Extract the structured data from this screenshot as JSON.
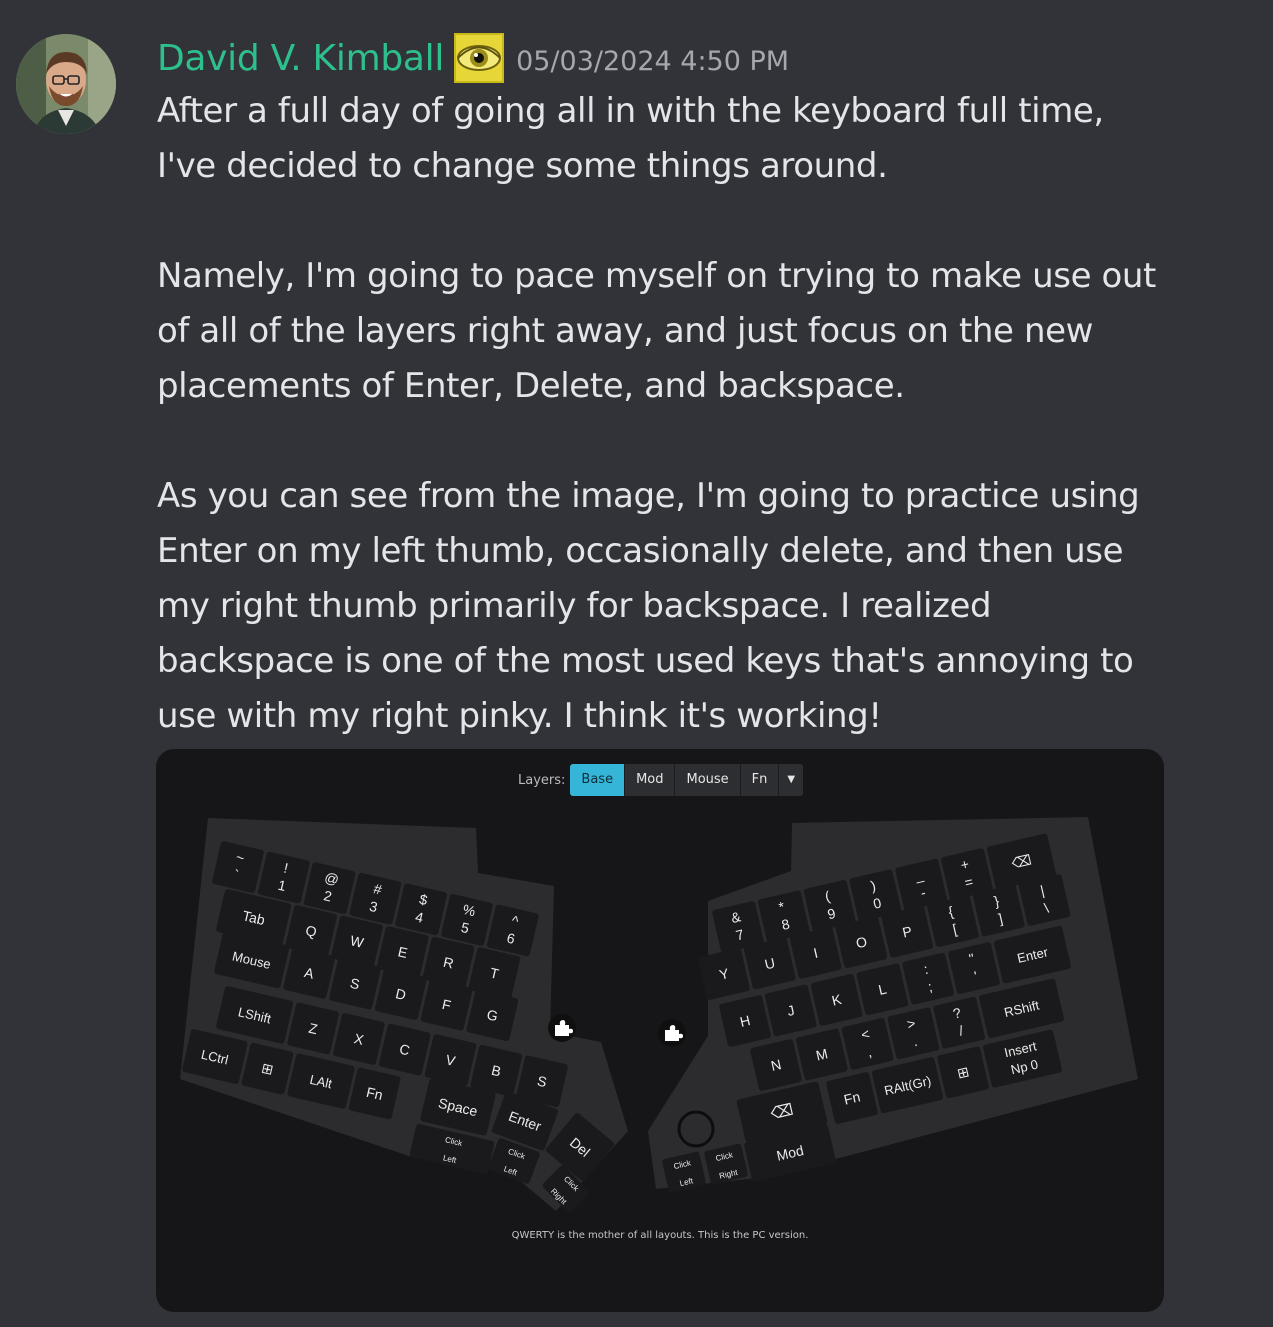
{
  "author": {
    "name": "David V. Kimball",
    "timestamp": "05/03/2024 4:50 PM",
    "name_color": "#2dc08d",
    "badge": "yellow-eye-icon"
  },
  "message": {
    "paragraphs": [
      "After a full day of going all in with the keyboard full time, I've decided to change some things around.",
      "Namely, I'm going to pace myself on trying to make use out of all of the layers right away, and just focus on the new placements of Enter, Delete, and backspace.",
      "As you can see from the image, I'm going to practice using Enter on my left thumb, occasionally delete, and then use my right thumb primarily for backspace. I realized backspace is one of the most used keys that's annoying to use with my right pinky. I think it's working!"
    ]
  },
  "attachment": {
    "layers_label": "Layers:",
    "tabs": [
      "Base",
      "Mod",
      "Mouse",
      "Fn"
    ],
    "active_tab": "Base",
    "caption": "QWERTY is the mother of all layouts. This is the PC version.",
    "accent": "#35b5d8",
    "keyboard": {
      "left_rows": [
        [
          [
            "~",
            "`"
          ],
          [
            "!",
            "1"
          ],
          [
            "@",
            "2"
          ],
          [
            "#",
            "3"
          ],
          [
            "$",
            "4"
          ],
          [
            "%",
            "5"
          ],
          [
            "^",
            "6"
          ]
        ],
        [
          [
            "Tab"
          ],
          [
            "Q"
          ],
          [
            "W"
          ],
          [
            "E"
          ],
          [
            "R"
          ],
          [
            "T"
          ]
        ],
        [
          [
            "Mouse"
          ],
          [
            "A"
          ],
          [
            "S"
          ],
          [
            "D"
          ],
          [
            "F"
          ],
          [
            "G"
          ]
        ],
        [
          [
            "LShift"
          ],
          [
            "Z"
          ],
          [
            "X"
          ],
          [
            "C"
          ],
          [
            "V"
          ],
          [
            "B"
          ],
          [
            "S"
          ]
        ],
        [
          [
            "LCtrl"
          ],
          [
            "⊞"
          ],
          [
            "LAlt"
          ],
          [
            "Fn"
          ]
        ]
      ],
      "right_rows": [
        [
          [
            "&",
            "7"
          ],
          [
            "*",
            "8"
          ],
          [
            "(",
            "9"
          ],
          [
            ")",
            "0"
          ],
          [
            "_",
            "-"
          ],
          [
            "+",
            "="
          ],
          [
            "⌫"
          ]
        ],
        [
          [
            "Y"
          ],
          [
            "U"
          ],
          [
            "I"
          ],
          [
            "O"
          ],
          [
            "P"
          ],
          [
            "{",
            "["
          ],
          [
            "}",
            "]"
          ],
          [
            "|",
            "\\"
          ]
        ],
        [
          [
            "H"
          ],
          [
            "J"
          ],
          [
            "K"
          ],
          [
            "L"
          ],
          [
            ":",
            ";"
          ],
          [
            "\"",
            "'"
          ],
          [
            "Enter"
          ]
        ],
        [
          [
            "N"
          ],
          [
            "M"
          ],
          [
            "<",
            ","
          ],
          [
            ">",
            "."
          ],
          [
            "?",
            "/"
          ],
          [
            "RShift"
          ]
        ],
        [
          [
            "Fn"
          ],
          [
            "RAlt(Gr)"
          ],
          [
            "⊞"
          ],
          [
            "Insert",
            "Np 0"
          ]
        ]
      ],
      "left_thumb": [
        "Space",
        "Enter",
        "Del"
      ],
      "right_thumb": [
        "⌫",
        "Mod"
      ],
      "mouse_click_left": [
        "Click",
        "Left"
      ],
      "mouse_click_right": [
        "Click",
        "Right"
      ]
    }
  }
}
